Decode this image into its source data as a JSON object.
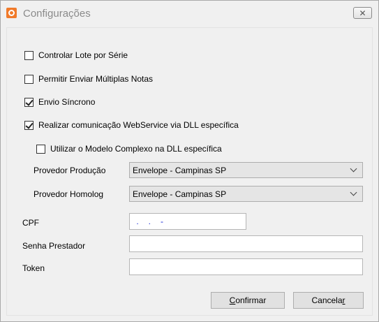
{
  "window": {
    "title": "Configurações",
    "close_glyph": "✕"
  },
  "checkboxes": [
    {
      "label": "Controlar Lote por Série",
      "checked": false
    },
    {
      "label": "Permitir Enviar Múltiplas Notas",
      "checked": false
    },
    {
      "label": "Envio Síncrono",
      "checked": true
    },
    {
      "label": "Realizar comunicação WebService via DLL específica",
      "checked": true
    },
    {
      "label": "Utilizar o Modelo Complexo na DLL específica",
      "checked": false
    }
  ],
  "providers": {
    "producao": {
      "label": "Provedor Produção",
      "value": "Envelope - Campinas SP"
    },
    "homolog": {
      "label": "Provedor Homolog",
      "value": "Envelope - Campinas SP"
    }
  },
  "fields": {
    "cpf": {
      "label": "CPF",
      "value": " .   .   -"
    },
    "senha": {
      "label": "Senha Prestador",
      "value": ""
    },
    "token": {
      "label": "Token",
      "value": ""
    }
  },
  "buttons": {
    "confirmar_first": "C",
    "confirmar_rest": "onfirmar",
    "cancelar_start": "Cancela",
    "cancelar_last": "r"
  }
}
